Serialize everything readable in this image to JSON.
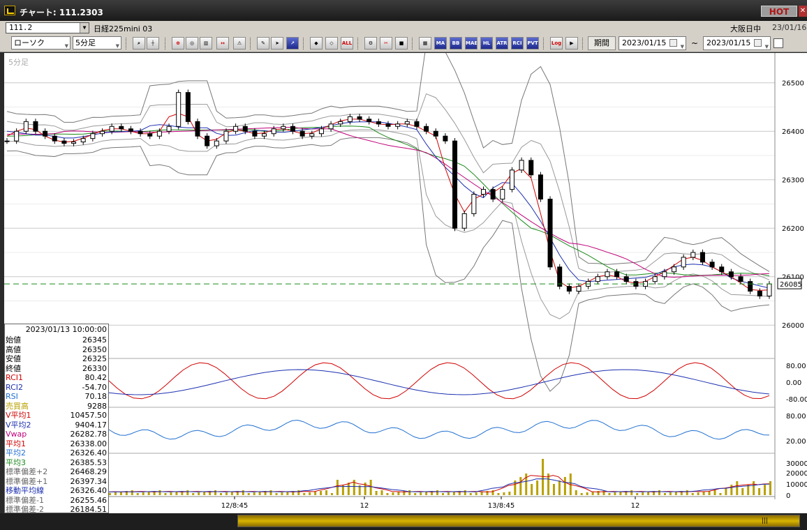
{
  "window": {
    "title": "チャート: 111.2303",
    "hot": "HOT"
  },
  "header": {
    "symbol_code": "111.2",
    "symbol_name": "日経225mini 03",
    "market": "大阪日中",
    "date": "23/01/16"
  },
  "toolbar": {
    "chart_type": "ローソク",
    "interval": "5分足",
    "period_label": "期間",
    "date_from": "2023/01/15",
    "date_to": "2023/01/15",
    "tilde": "~",
    "buttons": [
      "MA",
      "BB",
      "MAE",
      "HL",
      "ATR",
      "RCI",
      "PVT",
      "ALL",
      "Log"
    ]
  },
  "chart": {
    "timeframe_label": "5分足",
    "current_price_label": "26085",
    "y_ticks": [
      "26500",
      "26400",
      "26300",
      "26200",
      "26100",
      "26000"
    ],
    "rsi_ticks": [
      "80.00",
      "0.00",
      "-80.00"
    ],
    "rci_ticks": [
      "80.00",
      "20.00"
    ],
    "volume_ticks": [
      "30000",
      "20000",
      "10000",
      "0"
    ],
    "x_ticks": [
      "12/8:45",
      "12",
      "13/8:45",
      "12"
    ]
  },
  "data_panel": {
    "datetime": "2023/01/13 10:00:00",
    "rows": [
      {
        "label": "始値",
        "value": "26345",
        "color": "#000000"
      },
      {
        "label": "高値",
        "value": "26350",
        "color": "#000000"
      },
      {
        "label": "安値",
        "value": "26325",
        "color": "#000000"
      },
      {
        "label": "終値",
        "value": "26330",
        "color": "#000000"
      },
      {
        "label": "RCI1",
        "value": "80.42",
        "color": "#d00000"
      },
      {
        "label": "RCI2",
        "value": "-54.70",
        "color": "#1b2fb0"
      },
      {
        "label": "RSI",
        "value": "70.18",
        "color": "#1f6fd0"
      },
      {
        "label": "売買高",
        "value": "9288",
        "color": "#b8a000"
      },
      {
        "label": "V平均1",
        "value": "10457.50",
        "color": "#d00000"
      },
      {
        "label": "V平均2",
        "value": "9404.17",
        "color": "#1b2fb0"
      },
      {
        "label": "Vwap",
        "value": "26282.78",
        "color": "#c0007a"
      },
      {
        "label": "平均1",
        "value": "26338.00",
        "color": "#d00000"
      },
      {
        "label": "平均2",
        "value": "26326.40",
        "color": "#1f6fd0"
      },
      {
        "label": "平均3",
        "value": "26385.53",
        "color": "#1b8a1b"
      },
      {
        "label": "標準偏差+2",
        "value": "26468.29",
        "color": "#666666"
      },
      {
        "label": "標準偏差+1",
        "value": "26397.34",
        "color": "#666666"
      },
      {
        "label": "移動平均線",
        "value": "26326.40",
        "color": "#1b2fb0"
      },
      {
        "label": "標準偏差-1",
        "value": "26255.46",
        "color": "#666666"
      },
      {
        "label": "標準偏差-2",
        "value": "26184.51",
        "color": "#666666"
      }
    ]
  },
  "colors": {
    "candle": "#000000",
    "ma_fast": "#d00000",
    "ma_mid": "#1b2fb0",
    "ma_slow": "#1b8a1b",
    "vwap": "#c0007a",
    "bollinger": "#555555",
    "price_line": "#1b8a1b",
    "volume": "#b8a000"
  },
  "icons": [
    "zoom-icon",
    "crosshair-icon",
    "trend-icon",
    "cursor-icon",
    "pencil-icon",
    "gear-icon",
    "palette-icon"
  ],
  "chart_data": {
    "type": "line",
    "price_range": [
      25960,
      26550
    ],
    "current_price": 26085,
    "price_series": [
      26380,
      26400,
      26420,
      26400,
      26390,
      26380,
      26375,
      26378,
      26385,
      26395,
      26400,
      26410,
      26405,
      26400,
      26395,
      26390,
      26400,
      26410,
      26480,
      26420,
      26390,
      26370,
      26380,
      26400,
      26410,
      26400,
      26390,
      26395,
      26405,
      26410,
      26400,
      26390,
      26395,
      26405,
      26415,
      26420,
      26430,
      26425,
      26420,
      26415,
      26410,
      26415,
      26420,
      26410,
      26400,
      26390,
      26380,
      26200,
      26230,
      26270,
      26280,
      26260,
      26280,
      26320,
      26340,
      26310,
      26260,
      26120,
      26080,
      26070,
      26080,
      26090,
      26100,
      26110,
      26100,
      26090,
      26080,
      26090,
      26100,
      26110,
      26120,
      26140,
      26150,
      26130,
      26120,
      26110,
      26100,
      26090,
      26070,
      26060,
      26085
    ]
  }
}
